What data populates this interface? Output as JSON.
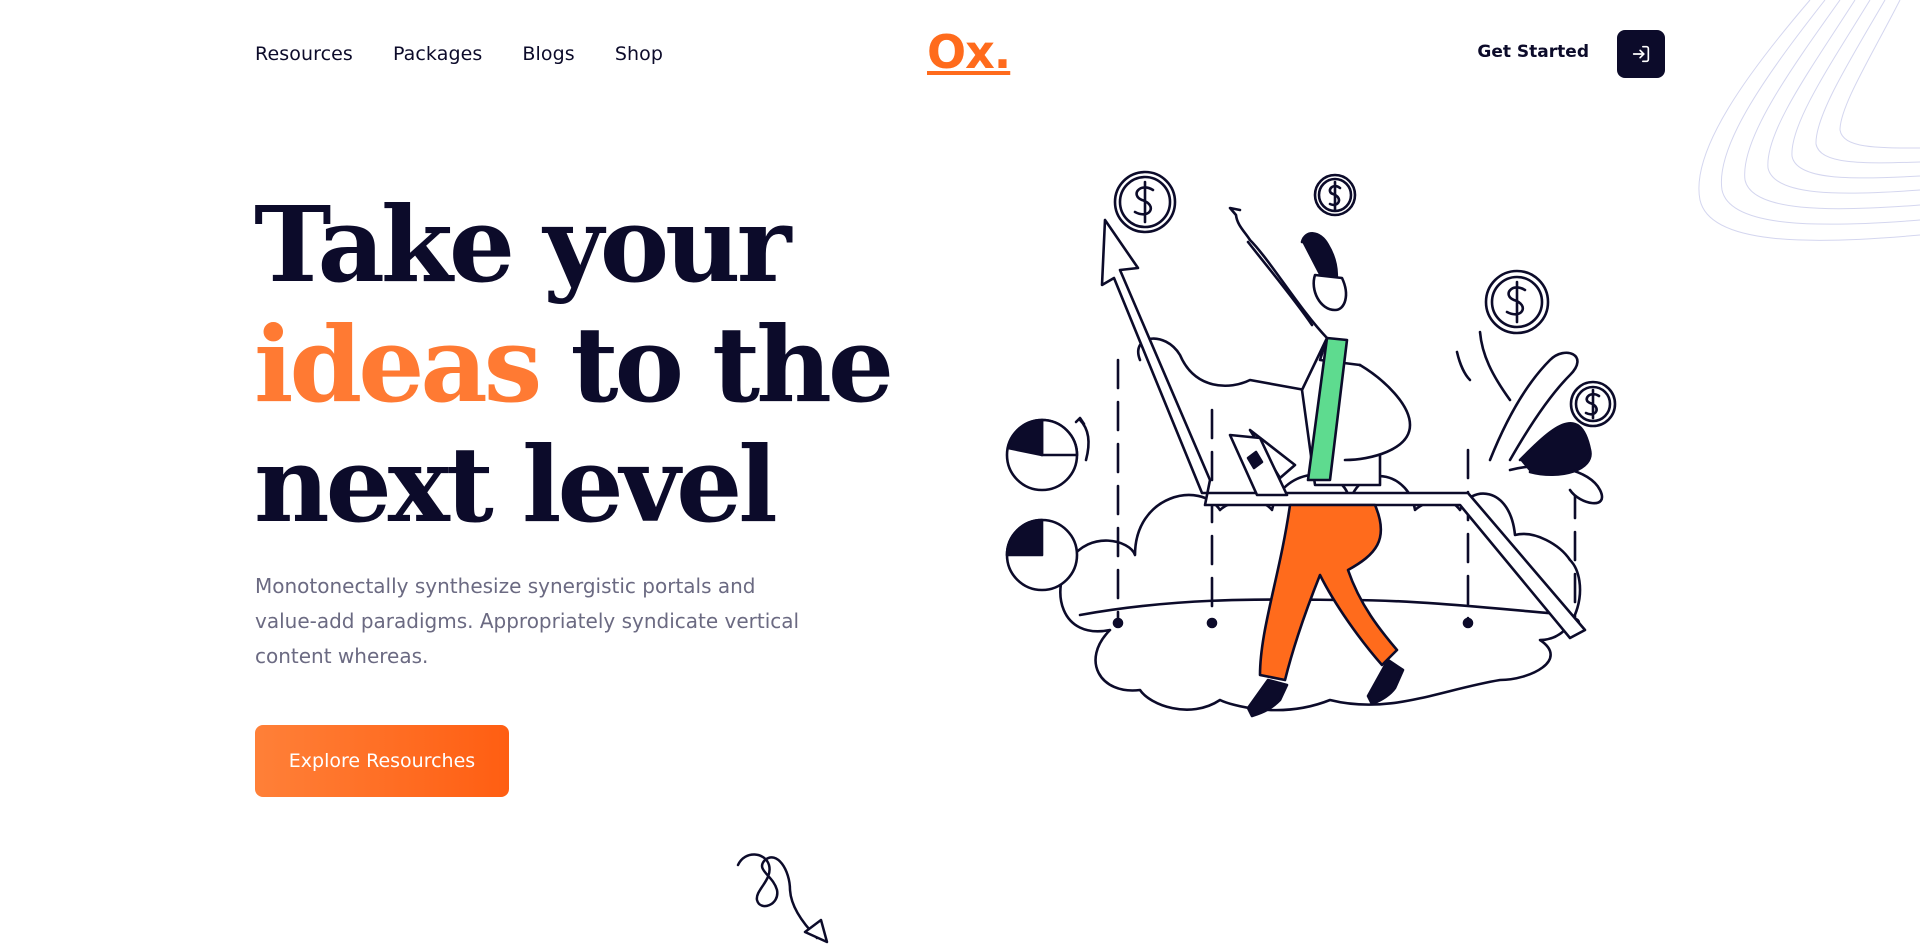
{
  "nav": {
    "items": [
      "Resources",
      "Packages",
      "Blogs",
      "Shop"
    ]
  },
  "brand": {
    "logo": "Ox.",
    "accent_color": "#ff6b1c",
    "dark_color": "#0c0b2a"
  },
  "header": {
    "get_started": "Get Started",
    "login_icon": "sign-in-icon"
  },
  "hero": {
    "title_line1": "Take your",
    "title_accent": "ideas",
    "title_line2_rest": " to the",
    "title_line3": "next level",
    "description": "Monotonectally synthesize synergistic portals and value-add paradigms. Appropriately syndicate vertical content whereas.",
    "cta_label": "Explore Resourches"
  },
  "illustration": {
    "subject": "person-pointing-up-with-laptop-on-growth-chart",
    "icons": [
      "dollar-coin-icon",
      "pie-chart-icon",
      "arrow-up-icon",
      "plant-icon",
      "cloud-icon"
    ]
  }
}
